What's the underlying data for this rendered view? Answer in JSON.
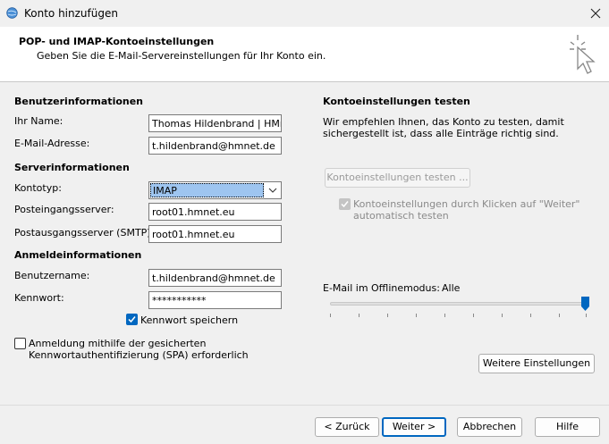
{
  "window": {
    "title": "Konto hinzufügen"
  },
  "header": {
    "title": "POP- und IMAP-Kontoeinstellungen",
    "subtitle": "Geben Sie die E-Mail-Servereinstellungen für Ihr Konto ein."
  },
  "user_info": {
    "section": "Benutzerinformationen",
    "name_label": "Ihr Name:",
    "name_value": "Thomas Hildenbrand | HMnet",
    "email_label": "E-Mail-Adresse:",
    "email_value": "t.hildenbrand@hmnet.de"
  },
  "server_info": {
    "section": "Serverinformationen",
    "type_label": "Kontotyp:",
    "type_value": "IMAP",
    "incoming_label": "Posteingangsserver:",
    "incoming_value": "root01.hmnet.eu",
    "outgoing_label": "Postausgangsserver (SMTP):",
    "outgoing_value": "root01.hmnet.eu"
  },
  "login_info": {
    "section": "Anmeldeinformationen",
    "user_label": "Benutzername:",
    "user_value": "t.hildenbrand@hmnet.de",
    "password_label": "Kennwort:",
    "password_value": "***********",
    "remember_label": "Kennwort speichern",
    "remember_checked": true,
    "spa_label_line1": "Anmeldung mithilfe der gesicherten",
    "spa_label_line2": "Kennwortauthentifizierung (SPA) erforderlich",
    "spa_checked": false
  },
  "test": {
    "section": "Kontoeinstellungen testen",
    "desc_line1": "Wir empfehlen Ihnen, das Konto zu testen, damit",
    "desc_line2": "sichergestellt ist, dass alle Einträge richtig sind.",
    "button": "Kontoeinstellungen testen ...",
    "auto_line1": "Kontoeinstellungen durch Klicken auf \"Weiter\"",
    "auto_line2": "automatisch testen",
    "auto_checked": true
  },
  "offline": {
    "label": "E-Mail im Offlinemodus:",
    "value": "Alle",
    "slider_fraction": 1.0
  },
  "more_button": "Weitere Einstellungen",
  "footer": {
    "back": "< Zurück",
    "next": "Weiter >",
    "cancel": "Abbrechen",
    "help": "Hilfe"
  },
  "colors": {
    "accent": "#0067c0",
    "selection": "#9ec5f0"
  },
  "icons": {
    "app": "outlook-globe-icon",
    "close": "close-icon",
    "header": "sparkle-cursor-icon",
    "combo": "chevron-down-icon",
    "check": "checkmark-icon"
  }
}
